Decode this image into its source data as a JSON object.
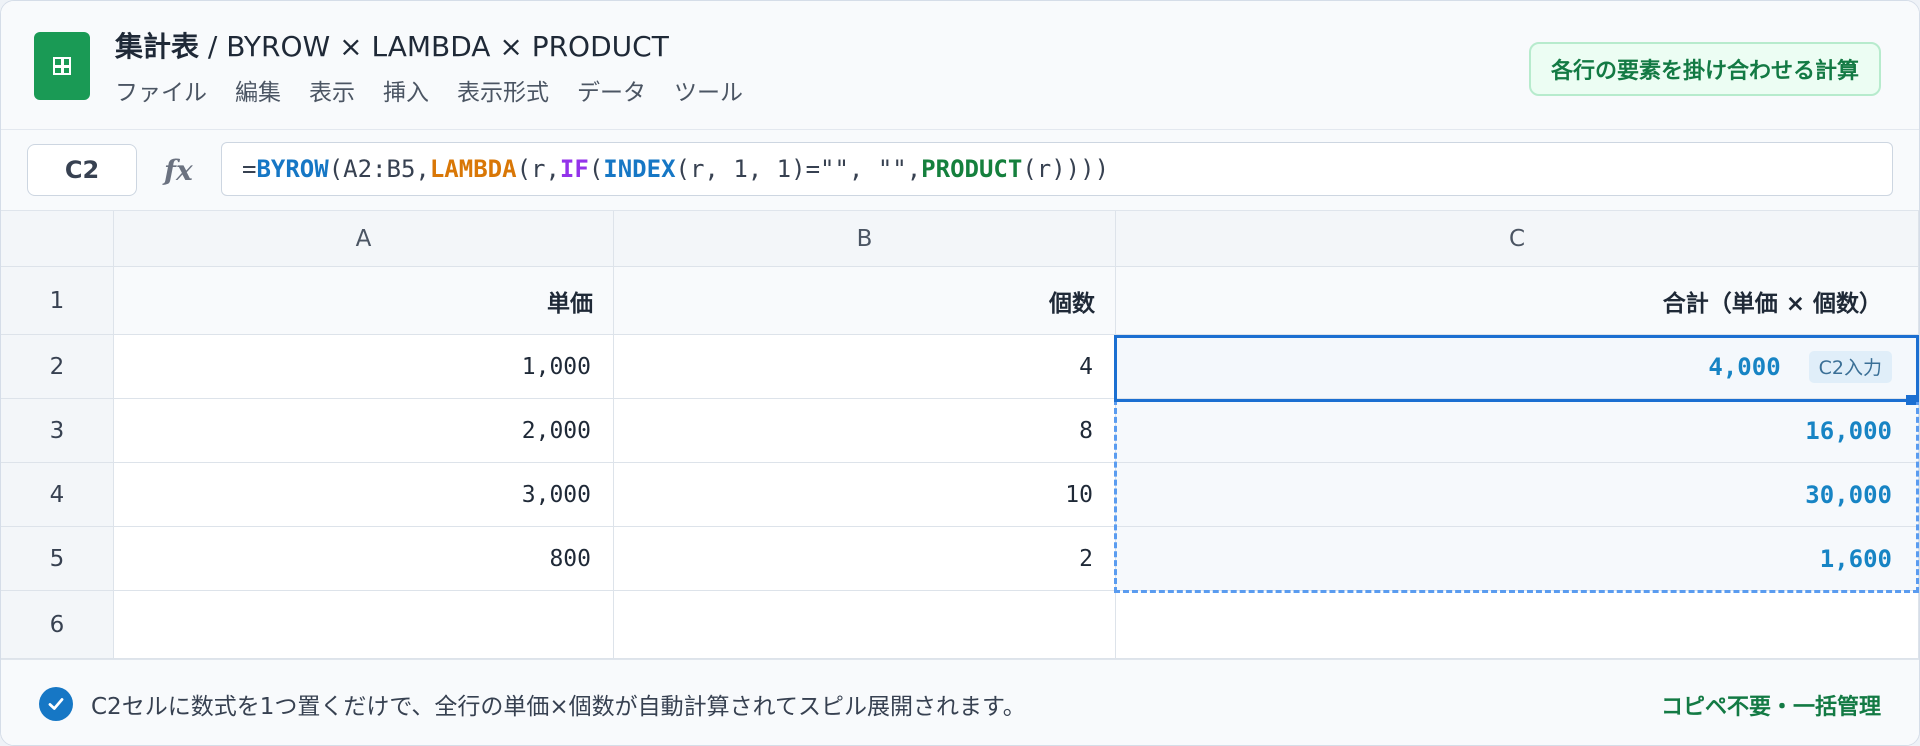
{
  "header": {
    "title_main": "集計表",
    "title_rest": " / BYROW × LAMBDA × PRODUCT",
    "menu": [
      "ファイル",
      "編集",
      "表示",
      "挿入",
      "表示形式",
      "データ",
      "ツール"
    ],
    "badge": "各行の要素を掛け合わせる計算",
    "app_color": "#1a9a55"
  },
  "formula_bar": {
    "cell_ref": "C2",
    "fx_label": "fx",
    "formula_parts": [
      "=",
      "BYROW",
      "(A2:B5,",
      "LAMBDA",
      "(r,",
      "IF",
      "(",
      "INDEX",
      "(r, 1, 1)=\"\", \"\",",
      "PRODUCT",
      "(r))))"
    ]
  },
  "grid": {
    "columns": [
      "A",
      "B",
      "C"
    ],
    "rows": [
      "1",
      "2",
      "3",
      "4",
      "5",
      "6"
    ],
    "headers": [
      "単価",
      "個数",
      "合計（単価 × 個数）"
    ],
    "data": [
      {
        "a": "1,000",
        "b": "4",
        "c": "4,000"
      },
      {
        "a": "2,000",
        "b": "8",
        "c": "16,000"
      },
      {
        "a": "3,000",
        "b": "10",
        "c": "30,000"
      },
      {
        "a": "800",
        "b": "2",
        "c": "1,600"
      }
    ],
    "input_tag": "C2入力",
    "accent_color": "#1b6fd1"
  },
  "footer": {
    "message": "C2セルに数式を1つ置くだけで、全行の単価×個数が自動計算されてスピル展開されます。",
    "right_label": "コピペ不要・一括管理"
  }
}
